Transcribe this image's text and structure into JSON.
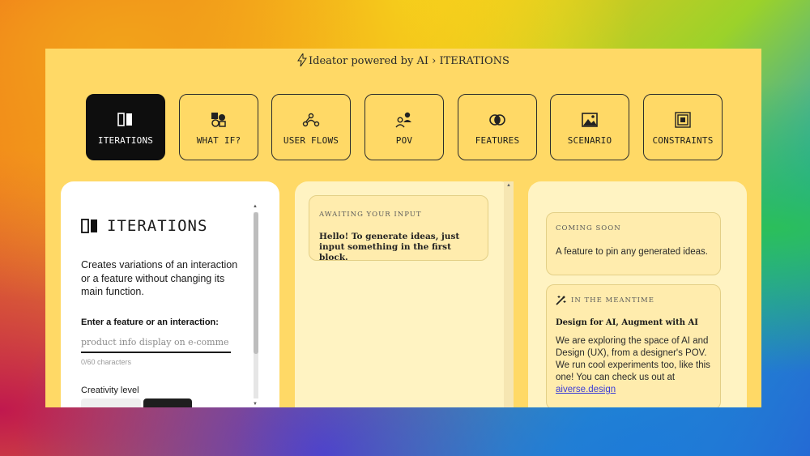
{
  "header": {
    "brand": "Ideator powered by AI",
    "separator": "›",
    "section": "ITERATIONS"
  },
  "tabs": [
    {
      "label": "ITERATIONS",
      "icon": "iterations-icon",
      "active": true
    },
    {
      "label": "WHAT IF?",
      "icon": "what-if-icon",
      "active": false
    },
    {
      "label": "USER FLOWS",
      "icon": "user-flows-icon",
      "active": false
    },
    {
      "label": "POV",
      "icon": "pov-icon",
      "active": false
    },
    {
      "label": "FEATURES",
      "icon": "features-icon",
      "active": false
    },
    {
      "label": "SCENARIO",
      "icon": "scenario-icon",
      "active": false
    },
    {
      "label": "CONSTRAINTS",
      "icon": "constraints-icon",
      "active": false
    }
  ],
  "input_panel": {
    "title": "ITERATIONS",
    "description": "Creates variations of an interaction or a feature without changing its main function.",
    "field_label": "Enter a feature or an interaction:",
    "placeholder": "product info display on e-comme",
    "char_count": "0/60 characters",
    "creativity_label": "Creativity level"
  },
  "output_panel": {
    "status": "AWAITING YOUR INPUT",
    "message": "Hello! To generate ideas, just input something in the first block."
  },
  "info_panel": {
    "coming_soon_label": "COMING SOON",
    "coming_soon_text": "A feature to pin any generated ideas.",
    "meantime_label": "IN THE MEANTIME",
    "meantime_title": "Design for AI, Augment with AI",
    "meantime_body": "We are exploring the space of AI and Design (UX), from a designer's POV. We run cool experiments too, like this one! You can check us out at",
    "link": "aiverse.design"
  },
  "colors": {
    "app_bg": "#ffd966",
    "card_bg": "#fff3c2",
    "active_tab": "#0e0e0e",
    "link": "#3b3bd6"
  }
}
